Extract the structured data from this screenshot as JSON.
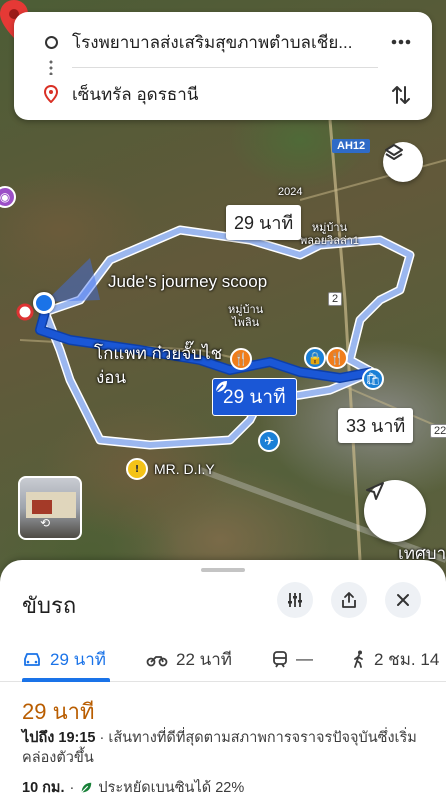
{
  "search": {
    "origin": "โรงพยาบาลส่งเสริมสุขภาพตำบลเชีย...",
    "destination": "เซ็นทรัล อุดรธานี"
  },
  "map": {
    "route_times": {
      "main": "29 นาที",
      "alt1": "29 นาที",
      "alt2": "33 นาที"
    },
    "labels": {
      "judes": "Jude's journey scoop",
      "kopat": "โกแพท ก๋วยจั๊บไช",
      "kopat2": "ง่อน",
      "village1": "หมู่บ้าน",
      "village1b": "พลอยวิลล่า1",
      "village2": "หมู่บ้าน",
      "village2b": "ไพลิน",
      "techno": "เทศบา",
      "mrdiy": "MR. D.I.Y",
      "year": "2024"
    },
    "roads": {
      "ah": "AH12",
      "r2": "2",
      "r22": "22"
    },
    "colors": {
      "primary_route": "#1a57d6",
      "alt_route": "#9bb7ef",
      "pin": "#e53935"
    }
  },
  "sheet": {
    "title": "ขับรถ",
    "modes": [
      {
        "icon": "car-icon",
        "label": "29 นาที"
      },
      {
        "icon": "motorcycle-icon",
        "label": "22 นาที"
      },
      {
        "icon": "train-icon",
        "label": "—"
      },
      {
        "icon": "walk-icon",
        "label": "2 ชม. 14"
      }
    ],
    "eta": "29 นาที",
    "arrive_label": "ไปถึง 19:15",
    "arrive_desc": " · เส้นทางที่ดีที่สุดตามสภาพการจราจรปัจจุบันซึ่งเริ่มคล่องตัวขึ้น",
    "distance": "10 กม.",
    "fuel": " · ",
    "fuel_text": "ประหยัดเบนซินได้ 22%"
  }
}
